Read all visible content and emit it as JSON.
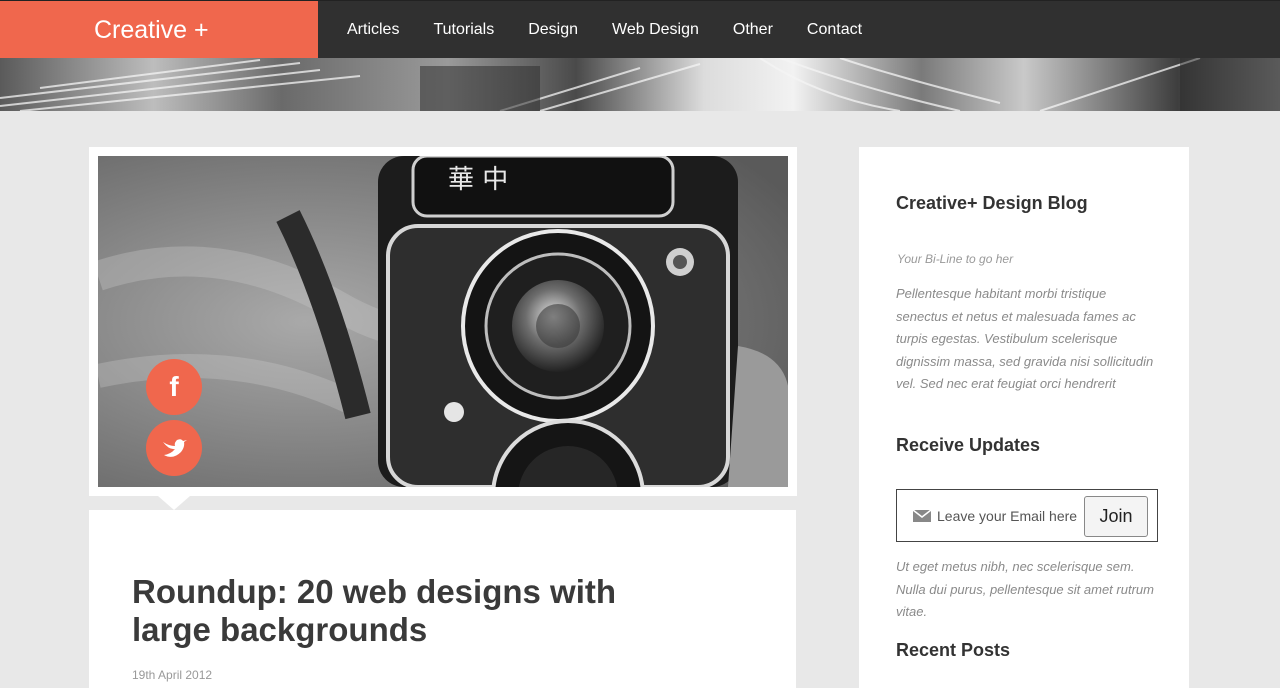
{
  "header": {
    "brand": "Creative +",
    "nav": [
      "Articles",
      "Tutorials",
      "Design",
      "Web Design",
      "Other",
      "Contact"
    ]
  },
  "post": {
    "title": "Roundup: 20 web designs with large backgrounds",
    "date": "19th April 2012",
    "social": {
      "facebook_glyph": "f"
    }
  },
  "sidebar": {
    "blog_title": "Creative+ Design Blog",
    "bline": "Your Bi-Line to go her",
    "intro": "Pellentesque habitant morbi tristique senectus et netus et malesuada fames ac turpis egestas. Vestibulum scelerisque dignissim massa, sed gravida nisi sollicitudin vel. Sed nec erat feugiat orci hendrerit",
    "updates_title": "Receive Updates",
    "email_placeholder": "Leave your Email here",
    "join_label": "Join",
    "updates_text": "Ut eget metus nibh, nec scelerisque sem. Nulla dui purus, pellentesque sit amet rutrum vitae.",
    "recent_title": "Recent Posts"
  },
  "colors": {
    "accent": "#f0674d",
    "topbar": "#303030",
    "page_bg": "#e8e8e8"
  },
  "icons": {
    "facebook": "facebook-icon",
    "twitter": "twitter-icon",
    "mail": "mail-icon"
  }
}
